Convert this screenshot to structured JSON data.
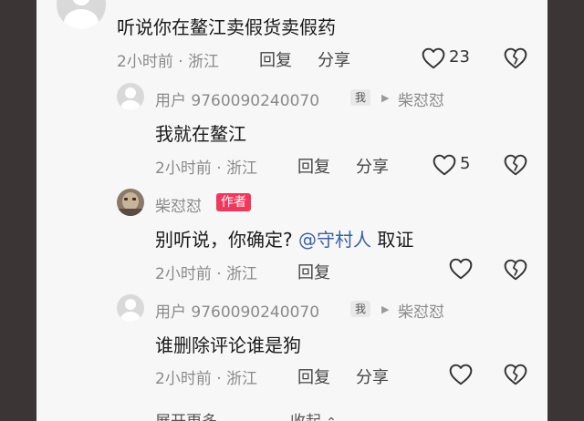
{
  "top_comment": {
    "text": "听说你在鳌江卖假货卖假药",
    "time_location": "2小时前 · 浙江",
    "reply_label": "回复",
    "share_label": "分享",
    "like_count": "23"
  },
  "replies": [
    {
      "username": "用户 9760090240070",
      "me_badge": "我",
      "reply_to": "柴怼怼",
      "text": "我就在鳌江",
      "time_location": "2小时前 · 浙江",
      "reply_label": "回复",
      "share_label": "分享",
      "like_count": "5"
    },
    {
      "username": "柴怼怼",
      "author_badge": "作者",
      "text_before": "别听说，你确定? ",
      "mention": "@守村人",
      "text_after": " 取证",
      "time_location": "2小时前 · 浙江",
      "reply_label": "回复"
    },
    {
      "username": "用户 9760090240070",
      "me_badge": "我",
      "reply_to": "柴怼怼",
      "text": "谁删除评论谁是狗",
      "time_location": "2小时前 · 浙江",
      "reply_label": "回复",
      "share_label": "分享"
    }
  ],
  "footer": {
    "expand_label": "展开更多",
    "collapse_label": "收起"
  },
  "colors": {
    "background": "#3b3536",
    "panel": "#f7f7f7",
    "author_badge": "#f0385c",
    "mention": "#3a5fa8"
  },
  "icons": [
    "user-avatar-icon",
    "heart-outline-icon",
    "broken-heart-icon",
    "reply-arrow-icon",
    "chevron-down-icon",
    "chevron-up-icon"
  ]
}
